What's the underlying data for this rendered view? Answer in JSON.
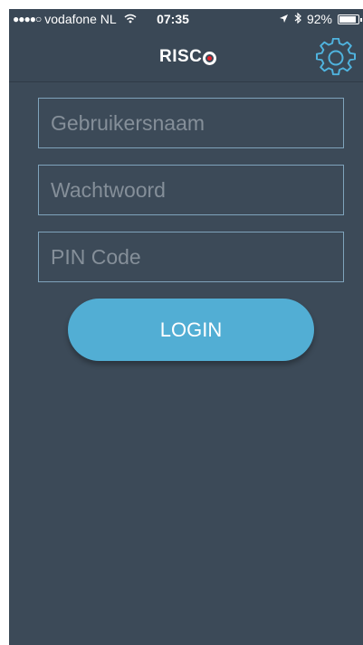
{
  "status_bar": {
    "signal": "●●●●○",
    "carrier": "vodafone NL",
    "time": "07:35",
    "battery": "92%",
    "battery_level": 0.92
  },
  "header": {
    "logo_text": "RISC",
    "settings_icon": "gear-icon"
  },
  "form": {
    "username_placeholder": "Gebruikersnaam",
    "password_placeholder": "Wachtwoord",
    "pin_placeholder": "PIN Code",
    "login_label": "LOGIN"
  },
  "colors": {
    "background": "#3c4a58",
    "field_border": "#7fa3bb",
    "button": "#52aed4",
    "logo_accent": "#e3262e"
  }
}
